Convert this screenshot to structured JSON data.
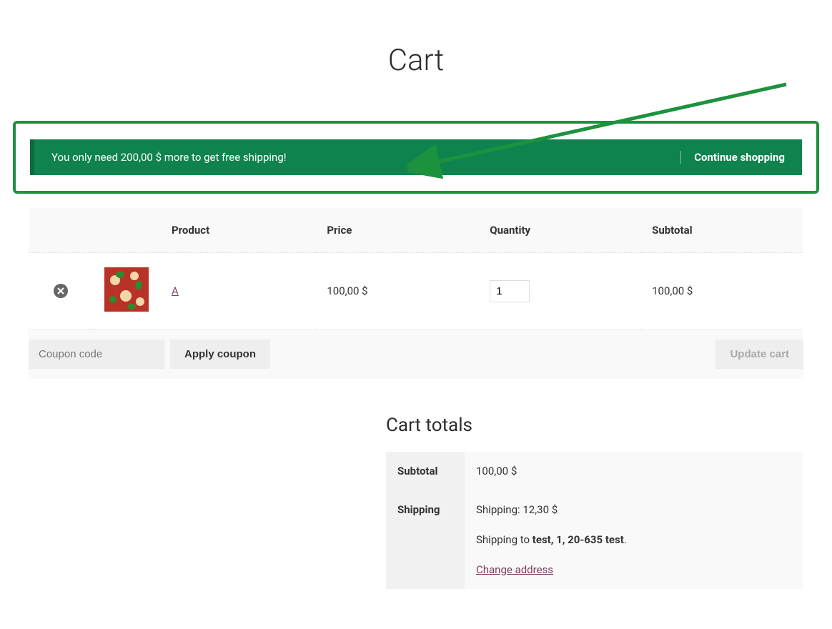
{
  "page": {
    "title": "Cart"
  },
  "notice": {
    "message": "You only need 200,00 $ more to get free shipping!",
    "continue_label": "Continue shopping"
  },
  "cart": {
    "headers": {
      "product": "Product",
      "price": "Price",
      "quantity": "Quantity",
      "subtotal": "Subtotal"
    },
    "item": {
      "name": "A",
      "price": "100,00 $",
      "quantity": "1",
      "subtotal": "100,00 $"
    },
    "coupon": {
      "placeholder": "Coupon code",
      "apply_label": "Apply coupon"
    },
    "update_label": "Update cart"
  },
  "totals": {
    "title": "Cart totals",
    "subtotal_label": "Subtotal",
    "subtotal_value": "100,00 $",
    "shipping_label": "Shipping",
    "shipping_value": "Shipping: 12,30 $",
    "shipping_to_prefix": "Shipping to ",
    "shipping_to_addr": "test, 1, 20-635 test",
    "shipping_to_suffix": ".",
    "change_address": "Change address"
  }
}
